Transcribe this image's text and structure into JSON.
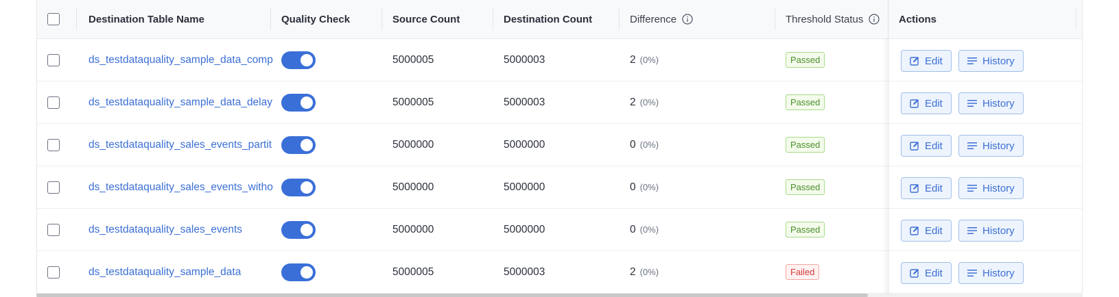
{
  "table": {
    "headers": {
      "name": "Destination Table Name",
      "quality": "Quality Check",
      "source": "Source Count",
      "destination": "Destination Count",
      "difference": "Difference",
      "threshold": "Threshold Status",
      "actions": "Actions"
    },
    "rows": [
      {
        "name": "ds_testdataquality_sample_data_comp",
        "quality_enabled": true,
        "source": "5000005",
        "destination": "5000003",
        "difference": "2",
        "percent": "(0%)",
        "status": "Passed"
      },
      {
        "name": "ds_testdataquality_sample_data_delay",
        "quality_enabled": true,
        "source": "5000005",
        "destination": "5000003",
        "difference": "2",
        "percent": "(0%)",
        "status": "Passed"
      },
      {
        "name": "ds_testdataquality_sales_events_partit",
        "quality_enabled": true,
        "source": "5000000",
        "destination": "5000000",
        "difference": "0",
        "percent": "(0%)",
        "status": "Passed"
      },
      {
        "name": "ds_testdataquality_sales_events_withou",
        "quality_enabled": true,
        "source": "5000000",
        "destination": "5000000",
        "difference": "0",
        "percent": "(0%)",
        "status": "Passed"
      },
      {
        "name": "ds_testdataquality_sales_events",
        "quality_enabled": true,
        "source": "5000000",
        "destination": "5000000",
        "difference": "0",
        "percent": "(0%)",
        "status": "Passed"
      },
      {
        "name": "ds_testdataquality_sample_data",
        "quality_enabled": true,
        "source": "5000005",
        "destination": "5000003",
        "difference": "2",
        "percent": "(0%)",
        "status": "Failed"
      }
    ],
    "actions": {
      "edit_label": "Edit",
      "history_label": "History"
    }
  },
  "colors": {
    "link": "#3b6fd4",
    "toggle_on": "#3a6fd8",
    "passed": "#4a8f2a",
    "failed": "#d4383a"
  }
}
